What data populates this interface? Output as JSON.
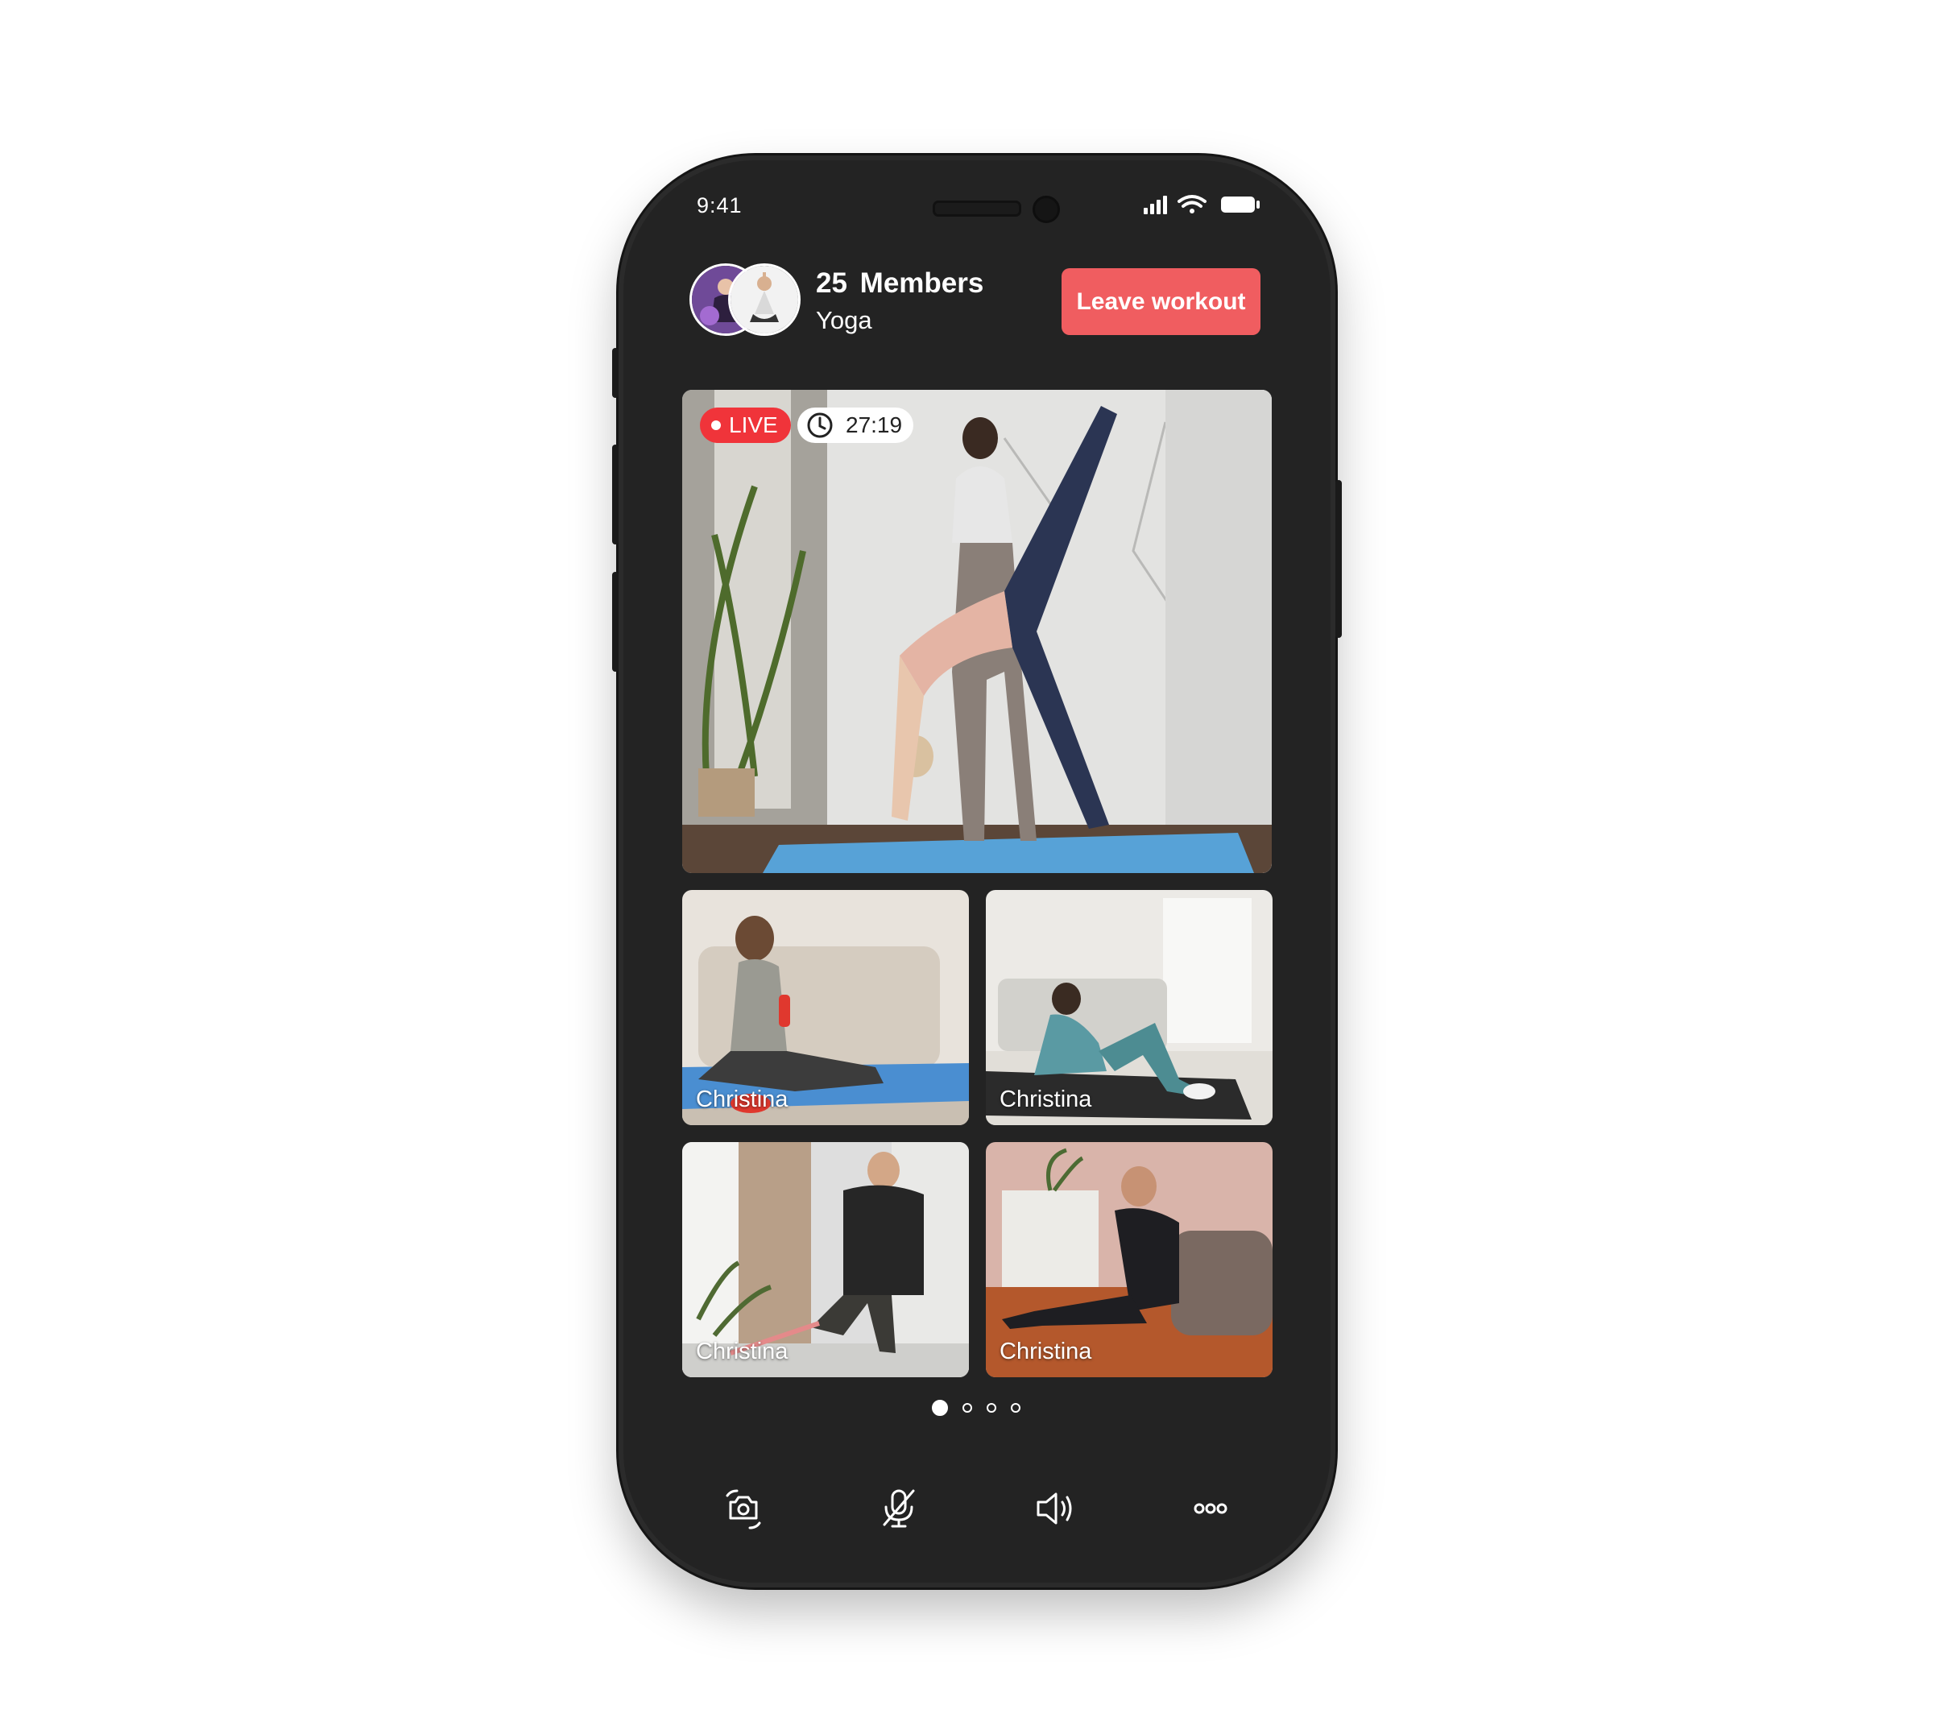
{
  "status_bar": {
    "time": "9:41"
  },
  "header": {
    "members_count": "25",
    "members_label": "Members",
    "class_name": "Yoga",
    "leave_button": "Leave workout"
  },
  "main_stream": {
    "live_label": "LIVE",
    "timer": "27:19"
  },
  "participants": [
    {
      "name": "Christina"
    },
    {
      "name": "Christina"
    },
    {
      "name": "Christina"
    },
    {
      "name": "Christina"
    }
  ],
  "pagination": {
    "total": 4,
    "active": 0
  },
  "controls": [
    {
      "icon": "flip-camera-icon"
    },
    {
      "icon": "mic-off-icon"
    },
    {
      "icon": "speaker-icon"
    },
    {
      "icon": "more-icon"
    }
  ],
  "colors": {
    "background": "#ffffff",
    "phone_body": "#232323",
    "accent_button": "#f05d60",
    "live_badge": "#f0343a"
  }
}
